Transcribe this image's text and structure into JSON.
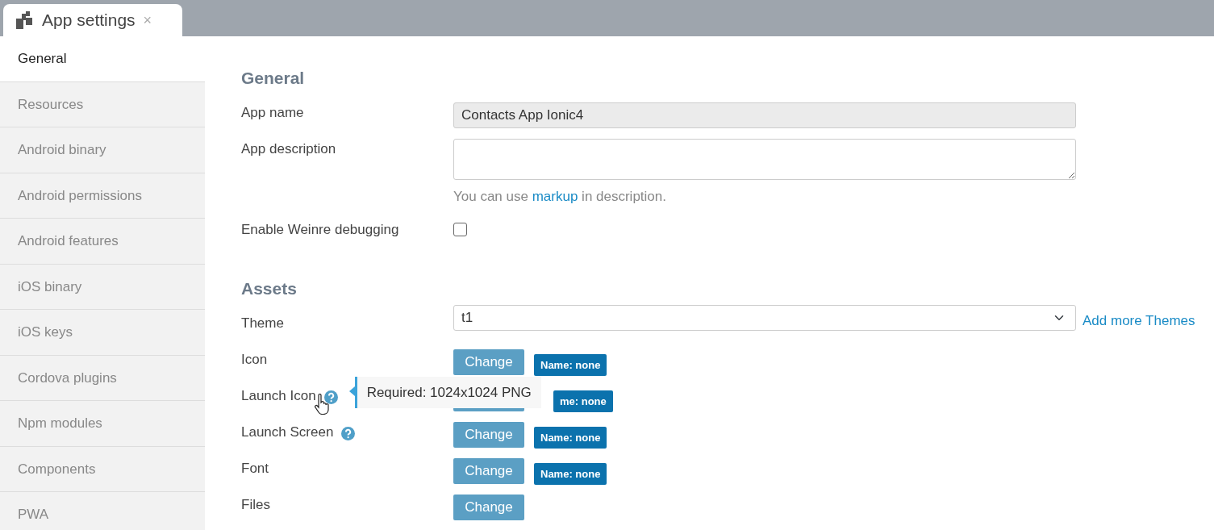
{
  "tab": {
    "title": "App settings",
    "close": "×"
  },
  "sidebar": {
    "items": [
      {
        "label": "General",
        "selected": true
      },
      {
        "label": "Resources",
        "selected": false
      },
      {
        "label": "Android binary",
        "selected": false
      },
      {
        "label": "Android permissions",
        "selected": false
      },
      {
        "label": "Android features",
        "selected": false
      },
      {
        "label": "iOS binary",
        "selected": false
      },
      {
        "label": "iOS keys",
        "selected": false
      },
      {
        "label": "Cordova plugins",
        "selected": false
      },
      {
        "label": "Npm modules",
        "selected": false
      },
      {
        "label": "Components",
        "selected": false
      },
      {
        "label": "PWA",
        "selected": false
      }
    ]
  },
  "general": {
    "heading": "General",
    "app_name": {
      "label": "App name",
      "value": "Contacts App Ionic4",
      "disabled": true
    },
    "app_description": {
      "label": "App description",
      "help_before": "You can use",
      "help_link": "markup",
      "help_after": "in description."
    },
    "weinre": {
      "label": "Enable Weinre debugging",
      "checked": false
    }
  },
  "assets": {
    "heading": "Assets",
    "theme": {
      "label": "Theme",
      "value": "t1",
      "link": "Add more Themes"
    },
    "rows": [
      {
        "label": "Icon",
        "help": false,
        "button": "Change",
        "badge": "Name: none"
      },
      {
        "label": "Launch Icon",
        "help": true,
        "button_covered": true,
        "badge": "me: none",
        "tooltip": "Required: 1024x1024 PNG"
      },
      {
        "label": "Launch Screen",
        "help": true,
        "button": "Change",
        "badge": "Name: none"
      },
      {
        "label": "Font",
        "help": false,
        "button": "Change",
        "badge": "Name: none"
      },
      {
        "label": "Files",
        "help": false,
        "button": "Change"
      }
    ]
  }
}
